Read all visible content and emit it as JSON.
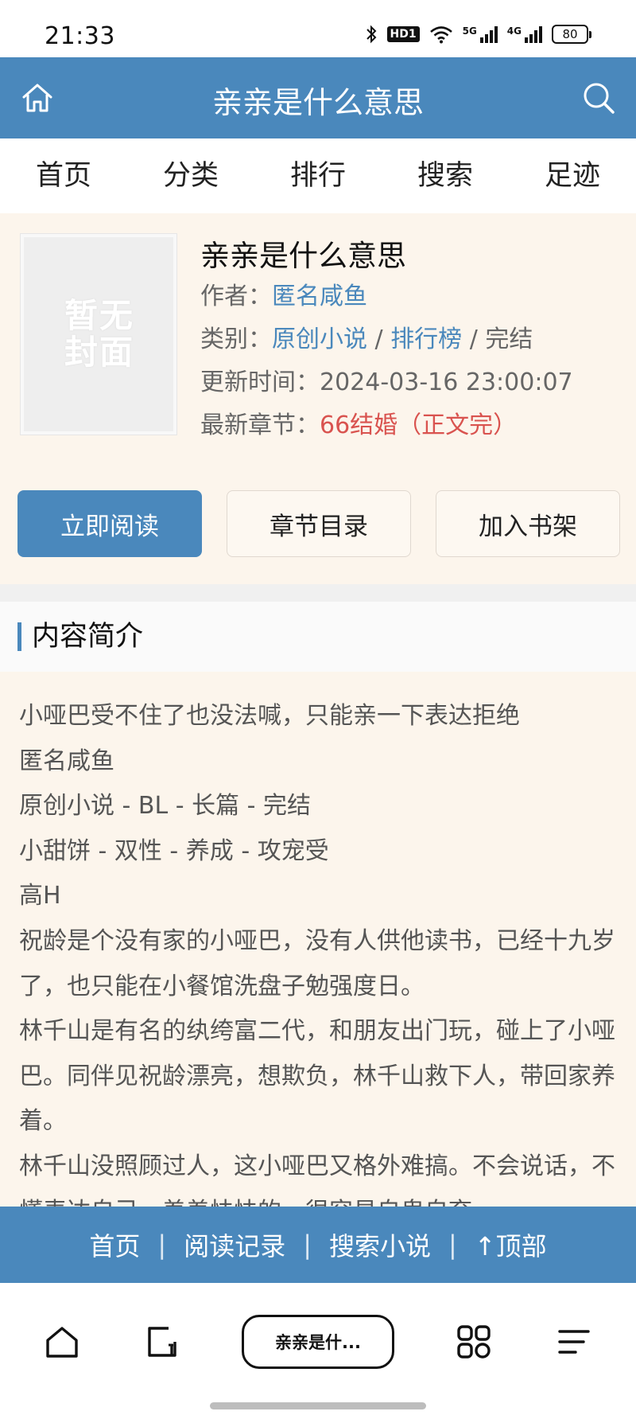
{
  "status_bar": {
    "time": "21:33",
    "hd_label": "HD1",
    "signal_5g": "5G",
    "signal_4g": "4G",
    "battery": "80"
  },
  "header": {
    "title": "亲亲是什么意思",
    "home_icon": "home-icon",
    "search_icon": "search-icon"
  },
  "nav": [
    "首页",
    "分类",
    "排行",
    "搜索",
    "足迹"
  ],
  "book": {
    "cover_text": [
      "暂",
      "无",
      "封",
      "面"
    ],
    "title": "亲亲是什么意思",
    "author_label": "作者：",
    "author": "匿名咸鱼",
    "category_label": "类别：",
    "category": "原创小说",
    "sep1": " / ",
    "category2": "排行榜",
    "sep2": " / ",
    "status": "完结",
    "updated_label": "更新时间：",
    "updated": "2024-03-16 23:00:07",
    "latest_label": "最新章节：",
    "latest": "66结婚（正文完）"
  },
  "buttons": {
    "read": "立即阅读",
    "catalog": "章节目录",
    "shelf": "加入书架"
  },
  "intro": {
    "heading": "内容简介",
    "lines": [
      "小哑巴受不住了也没法喊，只能亲一下表达拒绝",
      "匿名咸鱼",
      "原创小说 - BL - 长篇 - 完结",
      "小甜饼 - 双性 - 养成 - 攻宠受",
      "高H",
      "祝龄是个没有家的小哑巴，没有人供他读书，已经十九岁了，也只能在小餐馆洗盘子勉强度日。",
      "林千山是有名的纨绔富二代，和朋友出门玩，碰上了小哑巴。同伴见祝龄漂亮，想欺负，林千山救下人，带回家养着。",
      "林千山没照顾过人，这小哑巴又格外难搞。不会说话，不懂表达自己，羞羞怯怯的，很容易自卑自弃。"
    ]
  },
  "footer": {
    "links": [
      "首页",
      "阅读记录",
      "搜索小说",
      "↑顶部"
    ],
    "separator": "|"
  },
  "browser_bar": {
    "tab_label": "亲亲是什...",
    "icons": [
      "home-icon",
      "edit-icon",
      "apps-grid-icon",
      "menu-icon"
    ]
  },
  "colors": {
    "accent": "#4a88bc",
    "panel_bg": "#fcf5ec",
    "latest_chapter": "#d9534f"
  }
}
